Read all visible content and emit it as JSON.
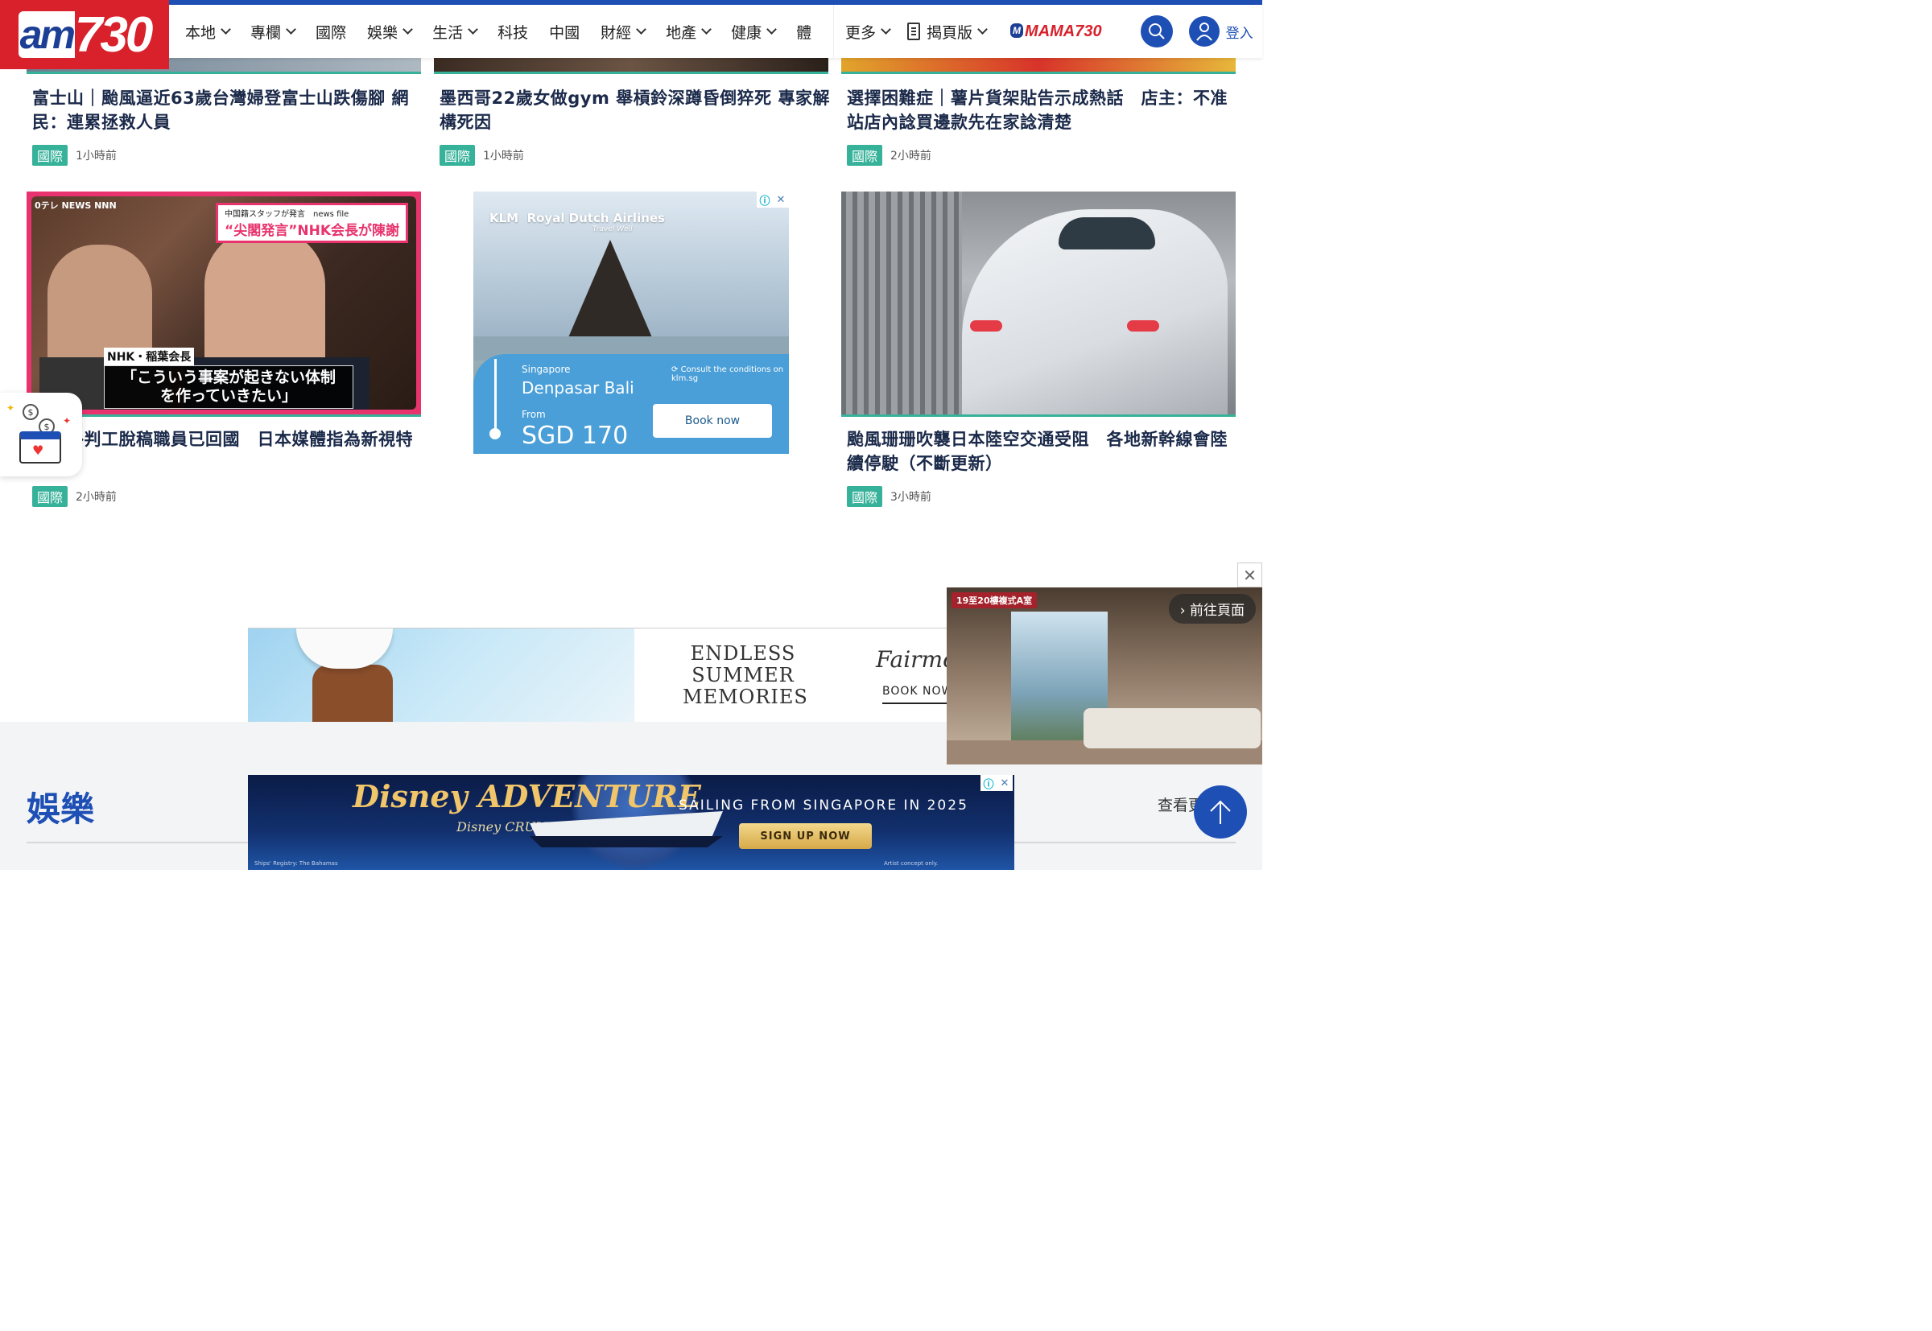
{
  "header": {
    "logo_text": "am730",
    "nav_items": [
      "本地",
      "專欄",
      "國際",
      "娛樂",
      "生活",
      "科技",
      "中國",
      "財經",
      "地產",
      "健康",
      "體"
    ],
    "more_label": "更多",
    "flip_label": "揭頁版",
    "mama_label": "MAMA730",
    "login_label": "登入"
  },
  "row1": [
    {
      "title": "富士山｜颱風逼近63歲台灣婦登富士山跌傷腳 網民：連累拯救人員",
      "tag": "國際",
      "time": "1小時前"
    },
    {
      "title": "墨西哥22歲女做gym 舉槓鈴深蹲昏倒猝死 專家解構死因",
      "tag": "國際",
      "time": "1小時前"
    },
    {
      "title": "選擇困難症｜薯片貨架貼告示成熱話　店主：不准站店內諗買邊款先在家諗清楚",
      "tag": "國際",
      "time": "2小時前"
    }
  ],
  "row2": [
    {
      "title": "中國外判工脫稿職員已回國　日本媒體指為新視特派員",
      "tag": "國際",
      "time": "2小時前"
    },
    {
      "title": "颱風珊珊吹襲日本陸空交通受阻　各地新幹線會陸續停駛（不斷更新）",
      "tag": "國際",
      "time": "3小時前"
    }
  ],
  "nhk_image": {
    "news_tag": "0テレ NEWS NNN",
    "top_small": "中国籍スタッフが発言　news file",
    "top_caption": "“尖閣発言”NHK会長が陳謝",
    "name_tag": "NHK・稲葉会長",
    "quote": "「こういう事案が起きない体制を作っていきたい」"
  },
  "klm_ad": {
    "brand": "Royal Dutch Airlines",
    "tagline": "Travel Well",
    "origin": "Singapore",
    "destination": "Denpasar Bali",
    "from_label": "From",
    "price": "SGD 170",
    "consult": "Consult the conditions on klm.sg",
    "book_label": "Book now"
  },
  "fairmont_ad": {
    "headline": "ENDLESS SUMMER MEMORIES",
    "brand": "Fairmont",
    "book_label": "BOOK NOW"
  },
  "video": {
    "label": "19至20樓複式A室",
    "go_label": "前往頁面"
  },
  "section": {
    "title": "娛樂",
    "more_label": "查看更多"
  },
  "disney_ad": {
    "logo": "Disney ADVENTURE",
    "sub": "Disney CRUISE LINE",
    "headline": "SAILING FROM SINGAPORE IN 2025",
    "button": "SIGN UP NOW",
    "registry": "Ships' Registry: The Bahamas",
    "fine": "Artist concept only."
  },
  "colors": {
    "brand_blue": "#1e4fb4",
    "brand_red": "#d8212b",
    "tag_teal": "#37b29a"
  }
}
